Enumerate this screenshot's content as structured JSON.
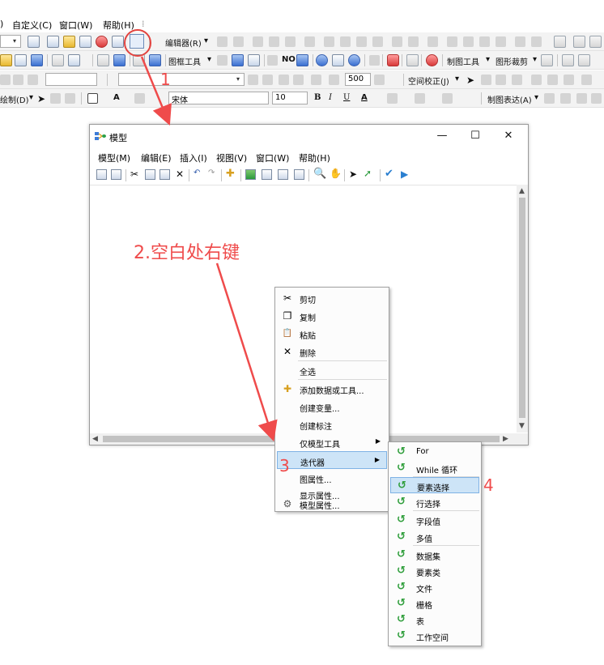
{
  "app": {
    "menu": [
      "自定义(C)",
      "窗口(W)",
      "帮助(H)"
    ],
    "toolbar1": {
      "editor": "编辑器(R)"
    },
    "toolbar2": {
      "frame_tools": "图框工具",
      "make_tools": "制图工具",
      "shape_clip": "图形裁剪"
    },
    "toolbar3": {
      "scale": "500",
      "spatial_adjust": "空间校正(J)"
    },
    "toolbar4": {
      "draw": "绘制(D)",
      "font": "宋体",
      "font_size": "10",
      "bold": "B",
      "italic": "I",
      "underline": "U",
      "text": "A",
      "cartography": "制图表达(A)"
    }
  },
  "model_window": {
    "title": "模型",
    "menu": [
      "模型(M)",
      "编辑(E)",
      "插入(I)",
      "视图(V)",
      "窗口(W)",
      "帮助(H)"
    ],
    "minimize": "—",
    "maximize": "☐",
    "close": "✕"
  },
  "context_menu": {
    "items": [
      {
        "label": "剪切",
        "icon": "scissors-icon",
        "glyph": "✂"
      },
      {
        "label": "复制",
        "icon": "copy-icon",
        "glyph": "❐"
      },
      {
        "label": "粘贴",
        "icon": "paste-icon",
        "glyph": "📋"
      },
      {
        "label": "删除",
        "icon": "delete-icon",
        "glyph": "✕"
      },
      {
        "label": "全选",
        "icon": "",
        "glyph": ""
      },
      {
        "label": "添加数据或工具...",
        "icon": "add-data-icon",
        "glyph": "✚"
      },
      {
        "label": "创建变量...",
        "icon": "",
        "glyph": ""
      },
      {
        "label": "创建标注",
        "icon": "",
        "glyph": ""
      },
      {
        "label": "仅模型工具",
        "icon": "",
        "glyph": "",
        "submenu": true
      },
      {
        "label": "迭代器",
        "icon": "",
        "glyph": "",
        "submenu": true,
        "highlighted": true
      },
      {
        "label": "图属性...",
        "icon": "",
        "glyph": ""
      },
      {
        "label": "显示属性...",
        "icon": "",
        "glyph": ""
      },
      {
        "label": "模型属性...",
        "icon": "model-properties-icon",
        "glyph": "⚙"
      }
    ]
  },
  "iterator_submenu": {
    "items": [
      "For",
      "While 循环",
      "要素选择",
      "行选择",
      "字段值",
      "多值",
      "数据集",
      "要素类",
      "文件",
      "栅格",
      "表",
      "工作空间"
    ],
    "highlighted_index": 2,
    "icon_glyph": "↺"
  },
  "annotations": {
    "step1": "1",
    "step2": "2.空白处右键",
    "step3": "3",
    "step4": "4"
  },
  "colors": {
    "annotation": "#ef4b4b",
    "highlight": "#cde4f7",
    "iterator_icon": "#2f9e3b"
  }
}
